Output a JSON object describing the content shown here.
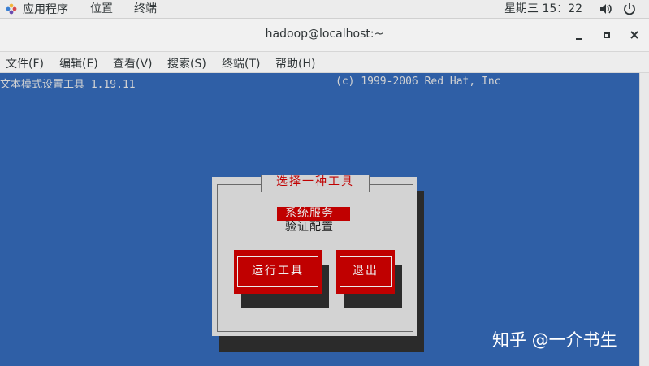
{
  "top_bar": {
    "applications": "应用程序",
    "places": "位置",
    "terminal": "终端",
    "clock": "星期三 15：22",
    "icons": [
      "gnome-apps-icon",
      "volume-icon",
      "power-icon"
    ]
  },
  "window": {
    "title": "hadoop@localhost:~",
    "controls": [
      "minimize-icon",
      "maximize-icon",
      "close-icon"
    ]
  },
  "menubar": {
    "file": "文件(F)",
    "edit": "编辑(E)",
    "view": "查看(V)",
    "search": "搜索(S)",
    "terminal": "终端(T)",
    "help": "帮助(H)"
  },
  "terminal": {
    "header_left": "文本模式设置工具 1.19.11",
    "header_right": "(c) 1999-2006 Red Hat, Inc"
  },
  "dialog": {
    "title": "选择一种工具",
    "items": [
      "系统服务",
      "验证配置"
    ],
    "selected_index": 0,
    "run_button": "运行工具",
    "quit_button": "退出"
  },
  "watermark": "知乎 @一介书生",
  "colors": {
    "terminal_bg": "#2f5fa6",
    "dialog_bg": "#d3d3d3",
    "accent_red": "#c00000"
  }
}
